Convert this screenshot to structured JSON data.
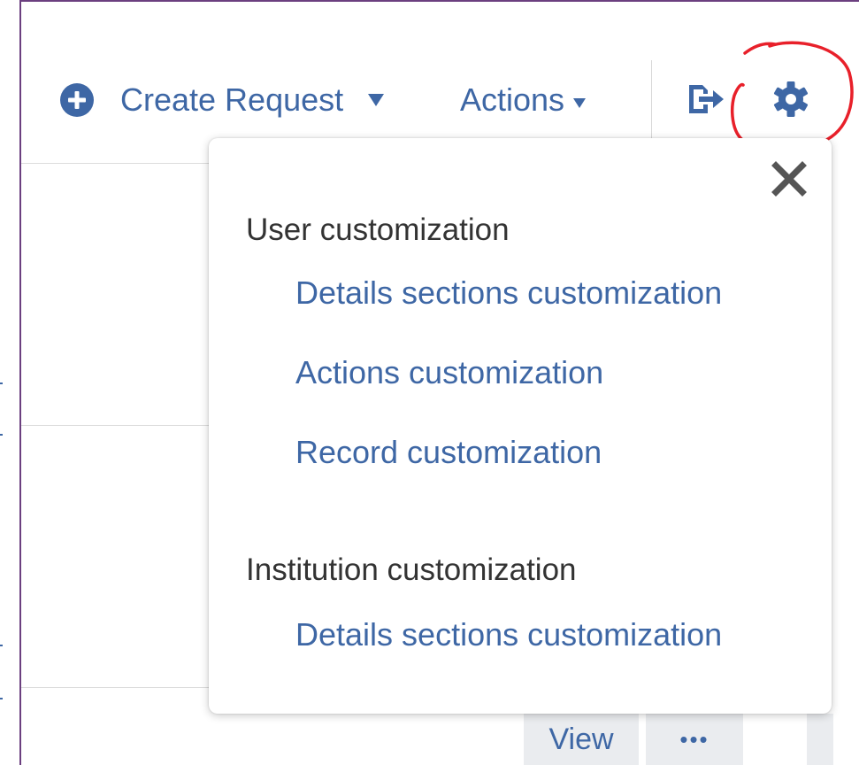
{
  "toolbar": {
    "create_label": "Create Request",
    "actions_label": "Actions"
  },
  "popup": {
    "user_section_title": "User customization",
    "user_items": [
      "Details sections customization",
      "Actions customization",
      "Record customization"
    ],
    "institution_section_title": "Institution customization",
    "institution_items": [
      "Details sections customization"
    ]
  },
  "row": {
    "view_label": "View",
    "more_label": "•••"
  },
  "icons": {
    "create": "plus-circle-icon",
    "dropdown": "caret-down-icon",
    "export": "export-icon",
    "settings": "gear-icon",
    "close": "close-icon",
    "more": "more-icon"
  },
  "colors": {
    "link": "#3e67a5",
    "heading": "#333333",
    "annotation": "#e8202a",
    "frame": "#6b3f7f"
  }
}
